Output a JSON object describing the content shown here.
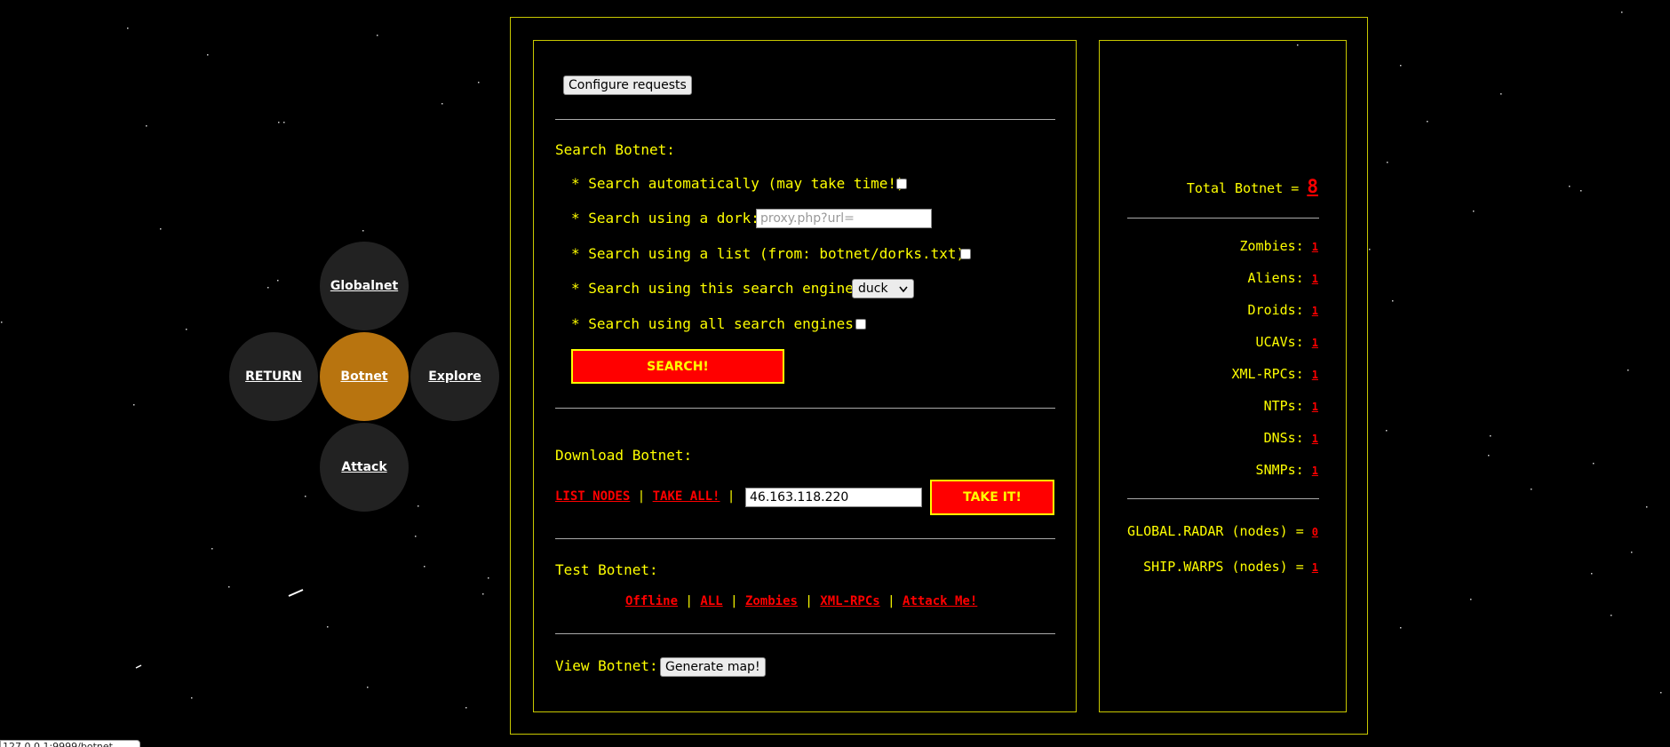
{
  "nav": {
    "globalnet": "Globalnet",
    "return": "RETURN",
    "botnet": "Botnet",
    "explore": "Explore",
    "attack": "Attack",
    "active_color": "#b8740f"
  },
  "requests": {
    "configure_label": "Configure requests"
  },
  "search": {
    "heading": "Search Botnet:",
    "auto_label": "* Search automatically (may take time!)",
    "dork_label": "* Search using a dork:",
    "dork_placeholder": "proxy.php?url=",
    "list_label": "* Search using a list (from: botnet/dorks.txt):",
    "engine_label": "* Search using this search engine:",
    "engine_selected": "duck",
    "all_engines_label": "* Search using all search engines:",
    "search_button": "SEARCH!"
  },
  "download": {
    "heading": "Download Botnet:",
    "list_nodes": "LIST NODES",
    "take_all": "TAKE ALL!",
    "separator": "|",
    "ip_value": "46.163.118.220",
    "take_it": "TAKE IT!"
  },
  "test": {
    "heading": "Test Botnet:",
    "links": [
      "Offline",
      "ALL",
      "Zombies",
      "XML-RPCs",
      "Attack Me!"
    ]
  },
  "view": {
    "heading": "View Botnet:",
    "generate_map": "Generate map!"
  },
  "stats": {
    "total_label": "Total Botnet =",
    "total_value": "8",
    "items": [
      {
        "label": "Zombies:",
        "value": "1"
      },
      {
        "label": "Aliens:",
        "value": "1"
      },
      {
        "label": "Droids:",
        "value": "1"
      },
      {
        "label": "UCAVs:",
        "value": "1"
      },
      {
        "label": "XML-RPCs:",
        "value": "1"
      },
      {
        "label": "NTPs:",
        "value": "1"
      },
      {
        "label": "DNSs:",
        "value": "1"
      },
      {
        "label": "SNMPs:",
        "value": "1"
      }
    ],
    "radar_label": "GLOBAL.RADAR (nodes) =",
    "radar_value": "0",
    "warps_label": "SHIP.WARPS (nodes) =",
    "warps_value": "1"
  },
  "status_bar": {
    "url": "127.0.0.1:9999/botnet"
  },
  "colors": {
    "text": "#ffff00",
    "link": "#ff0000",
    "frame": "#c8c800",
    "background": "#000000"
  }
}
